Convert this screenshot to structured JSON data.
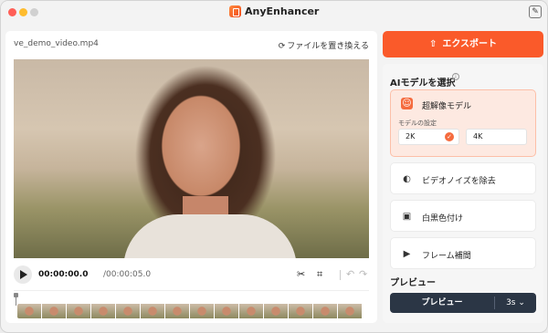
{
  "app": {
    "title": "AnyEnhancer"
  },
  "player": {
    "filename": "ve_demo_video.mp4",
    "replace_label": "ファイルを置き換える",
    "current_time": "00:00:00.0",
    "total_time": "/00:00:05.0"
  },
  "sidebar": {
    "export_label": "エクスポート",
    "ai_section_title": "AIモデルを選択",
    "models": [
      {
        "label": "超解像モデル",
        "icon": "robot-icon"
      },
      {
        "label": "ビデオノイズを除去",
        "icon": "denoise-icon"
      },
      {
        "label": "白黒色付け",
        "icon": "colorize-icon"
      },
      {
        "label": "フレーム補間",
        "icon": "frame-interpolation-icon"
      }
    ],
    "settings_label": "モデルの設定",
    "resolutions": [
      {
        "label": "2K",
        "selected": true
      },
      {
        "label": "4K",
        "selected": false
      }
    ],
    "preview_title": "プレビュー",
    "preview_button": "プレビュー",
    "preview_duration": "3s ⌄"
  },
  "colors": {
    "accent": "#fa5a2a",
    "preview_bar": "#2b3645"
  }
}
